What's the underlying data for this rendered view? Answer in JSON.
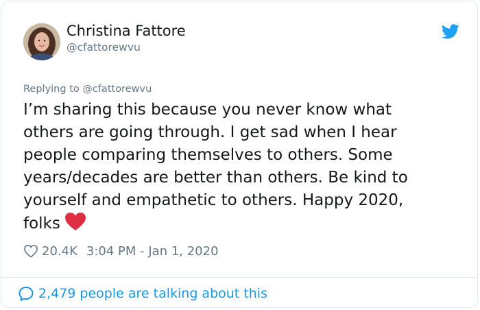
{
  "author": {
    "display_name": "Christina Fattore",
    "handle": "@cfattorewvu"
  },
  "reply": {
    "text": "Replying to @cfattorewvu"
  },
  "tweet": {
    "lines": [
      "I’m sharing this because you never know what",
      "others are going through. I get sad when I hear",
      "people comparing themselves to others. Some",
      "years/decades are better than others. Be kind to",
      "yourself and empathetic to others. Happy 2020,",
      "folks"
    ],
    "emoji": "red-heart-emoji"
  },
  "meta": {
    "like_count": "20.4K",
    "timestamp": "3:04 PM - Jan 1, 2020",
    "like_icon": "heart-outline-icon"
  },
  "footer": {
    "talking_text": "2,479 people are talking about this",
    "icon": "speech-bubble-icon"
  },
  "colors": {
    "twitter_blue": "#1da1f2",
    "link_blue": "#1b95e0",
    "secondary_text": "#657786",
    "heart_red": "#e0245e"
  }
}
